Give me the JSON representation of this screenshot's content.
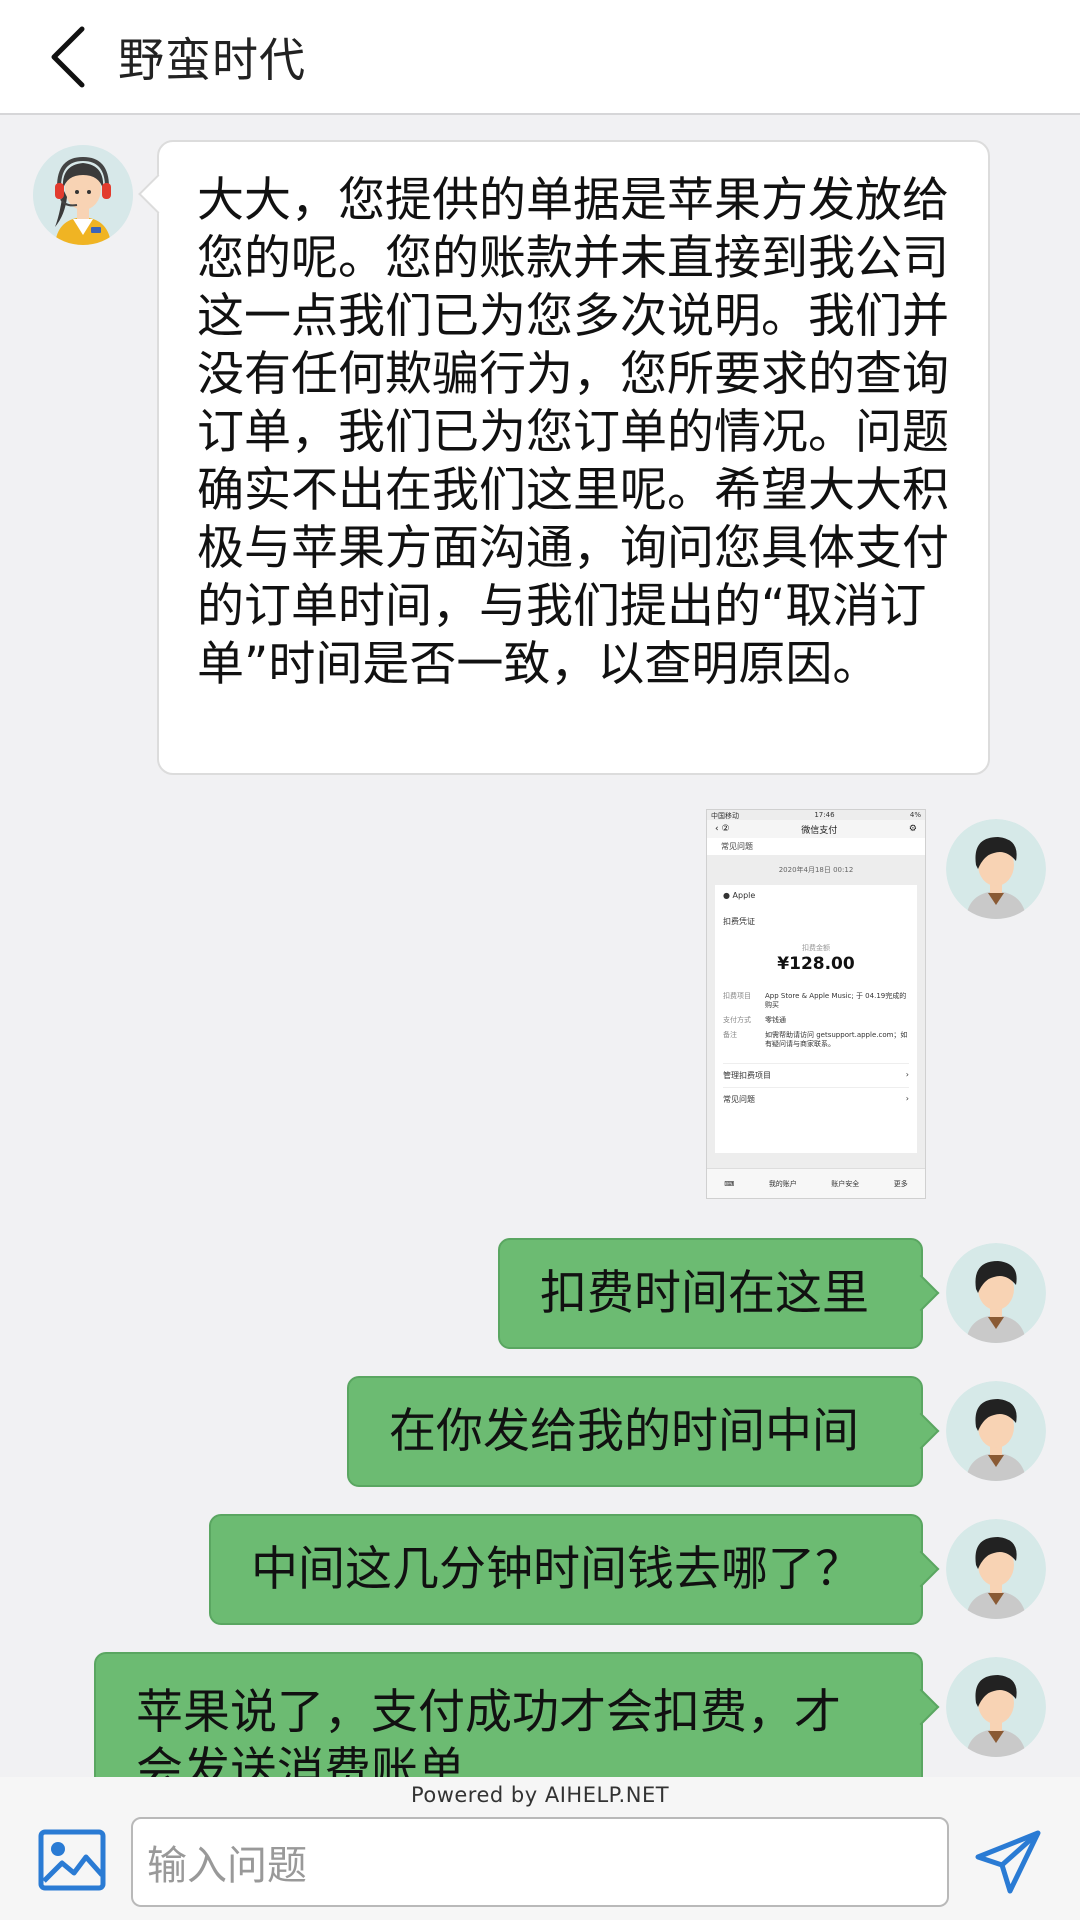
{
  "header": {
    "title": "野蛮时代",
    "back_icon": "chevron-left-icon"
  },
  "messages": {
    "agent_text": "大大，您提供的单据是苹果方发放给您的呢。您的账款并未直接到我公司这一点我们已为您多次说明。我们并没有任何欺骗行为，您所要求的查询订单，我们已为您订单的情况。问题确实不出在我们这里呢。希望大大积极与苹果方面沟通，询问您具体支付的订单时间，与我们提出的“取消订单”时间是否一致，以查明原因。",
    "user_1": "扣费时间在这里",
    "user_2": "在你发给我的时间中间",
    "user_3": "中间这几分钟时间钱去哪了？",
    "user_4": "苹果说了，支付成功才会扣费，才会发送消费账单"
  },
  "screenshot": {
    "status_left": "中国移动",
    "status_time": "17:46",
    "status_right": "4%",
    "nav_title": "微信支付",
    "top_row": "常见问题",
    "date": "2020年4月18日 00:12",
    "merchant": "Apple",
    "voucher": "扣费凭证",
    "amount_label": "扣费金额",
    "amount": "¥128.00",
    "detail_1_k": "扣费项目",
    "detail_1_v": "App Store & Apple Music; 于 04.19完成的购买",
    "detail_2_k": "支付方式",
    "detail_2_v": "零钱通",
    "detail_3_k": "备注",
    "detail_3_v": "如需帮助请访问 getsupport.apple.com；如有疑问请与商家联系。",
    "link_1": "管理扣费项目",
    "link_2": "常见问题",
    "tab_1": "我的账户",
    "tab_2": "账户安全",
    "tab_3": "更多"
  },
  "footer": {
    "powered": "Powered by AIHELP.NET",
    "input_placeholder": "输入问题",
    "image_icon": "image-icon",
    "send_icon": "send-icon"
  },
  "colors": {
    "user_bubble": "#6cbb72",
    "accent": "#2a7bd4",
    "background": "#f1f1f3"
  }
}
